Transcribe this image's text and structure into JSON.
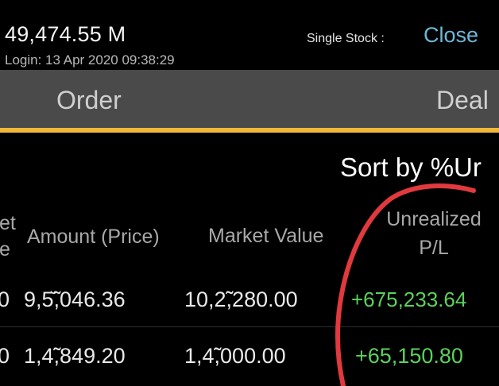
{
  "header": {
    "balance": "49,474.55 M",
    "login": "Login: 13 Apr 2020 09:38:29",
    "single_stock_label": "Single Stock :",
    "close_label": "Close"
  },
  "tabs": [
    {
      "label": "Order"
    },
    {
      "label": "Deal"
    }
  ],
  "sort_label": "Sort by %Ur",
  "columns": {
    "partial_line1": "et",
    "partial_line2": "e",
    "amount": "Amount (Price)",
    "market_value": "Market Value",
    "unrealized_line1": "Unrealized",
    "unrealized_line2": "P/L"
  },
  "rows": [
    {
      "first": "0",
      "amount": "9,5̆̃,046.36",
      "market_value": "10,2̃̃,280.00",
      "unrealized": "+675,233.64"
    },
    {
      "first": "0",
      "amount": "1,4̃̃,849.20",
      "market_value": "1,4̃̃,000.00",
      "unrealized": "+65,150.80"
    }
  ],
  "colors": {
    "accent": "#f2b83a",
    "positive": "#5bd15b",
    "link": "#6fb7d6",
    "annotation": "#e0393e"
  }
}
